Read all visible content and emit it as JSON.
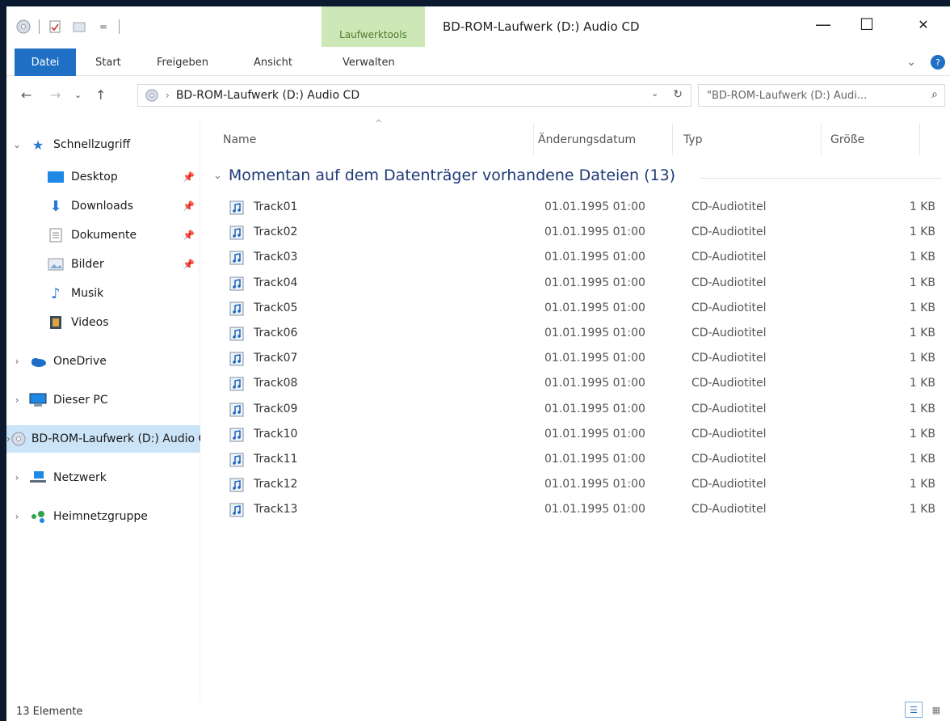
{
  "window": {
    "title": "BD-ROM-Laufwerk (D:) Audio CD",
    "context_tab_label": "Laufwerktools",
    "minimize_label": "—",
    "maximize_label": "☐",
    "close_label": "✕"
  },
  "ribbon": {
    "tabs": [
      "Datei",
      "Start",
      "Freigeben",
      "Ansicht",
      "Verwalten"
    ],
    "expand_label": "⌄",
    "help_label": "?"
  },
  "address": {
    "path": "BD-ROM-Laufwerk (D:) Audio CD",
    "search_placeholder": "\"BD-ROM-Laufwerk (D:) Audi..."
  },
  "navpane": {
    "items": [
      {
        "label": "Schnellzugriff",
        "icon": "star-icon"
      },
      {
        "label": "Desktop",
        "icon": "desktop-icon"
      },
      {
        "label": "Downloads",
        "icon": "download-icon"
      },
      {
        "label": "Dokumente",
        "icon": "document-icon"
      },
      {
        "label": "Bilder",
        "icon": "pictures-icon"
      },
      {
        "label": "Musik",
        "icon": "music-icon"
      },
      {
        "label": "Videos",
        "icon": "videos-icon"
      },
      {
        "label": "OneDrive",
        "icon": "cloud-icon"
      },
      {
        "label": "Dieser PC",
        "icon": "computer-icon"
      },
      {
        "label": "BD-ROM-Laufwerk (D:) Audio CD",
        "icon": "disc-icon"
      },
      {
        "label": "Netzwerk",
        "icon": "network-icon"
      },
      {
        "label": "Heimnetzgruppe",
        "icon": "homegroup-icon"
      }
    ]
  },
  "columns": {
    "name": "Name",
    "date": "Änderungsdatum",
    "type": "Typ",
    "size": "Größe"
  },
  "group": {
    "label": "Momentan auf dem Datenträger vorhandene Dateien (13)"
  },
  "files": [
    {
      "name": "Track01",
      "date": "01.01.1995 01:00",
      "type": "CD-Audiotitel",
      "size": "1 KB"
    },
    {
      "name": "Track02",
      "date": "01.01.1995 01:00",
      "type": "CD-Audiotitel",
      "size": "1 KB"
    },
    {
      "name": "Track03",
      "date": "01.01.1995 01:00",
      "type": "CD-Audiotitel",
      "size": "1 KB"
    },
    {
      "name": "Track04",
      "date": "01.01.1995 01:00",
      "type": "CD-Audiotitel",
      "size": "1 KB"
    },
    {
      "name": "Track05",
      "date": "01.01.1995 01:00",
      "type": "CD-Audiotitel",
      "size": "1 KB"
    },
    {
      "name": "Track06",
      "date": "01.01.1995 01:00",
      "type": "CD-Audiotitel",
      "size": "1 KB"
    },
    {
      "name": "Track07",
      "date": "01.01.1995 01:00",
      "type": "CD-Audiotitel",
      "size": "1 KB"
    },
    {
      "name": "Track08",
      "date": "01.01.1995 01:00",
      "type": "CD-Audiotitel",
      "size": "1 KB"
    },
    {
      "name": "Track09",
      "date": "01.01.1995 01:00",
      "type": "CD-Audiotitel",
      "size": "1 KB"
    },
    {
      "name": "Track10",
      "date": "01.01.1995 01:00",
      "type": "CD-Audiotitel",
      "size": "1 KB"
    },
    {
      "name": "Track11",
      "date": "01.01.1995 01:00",
      "type": "CD-Audiotitel",
      "size": "1 KB"
    },
    {
      "name": "Track12",
      "date": "01.01.1995 01:00",
      "type": "CD-Audiotitel",
      "size": "1 KB"
    },
    {
      "name": "Track13",
      "date": "01.01.1995 01:00",
      "type": "CD-Audiotitel",
      "size": "1 KB"
    }
  ],
  "status": {
    "count_label": "13 Elemente"
  },
  "colors": {
    "accent": "#1f6fc4",
    "context_tab": "#cde8b6",
    "selected": "#cce4f7",
    "group_text": "#1e3a78"
  }
}
